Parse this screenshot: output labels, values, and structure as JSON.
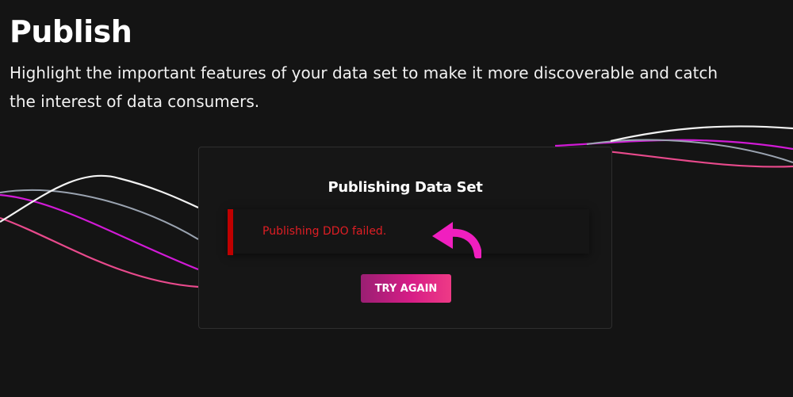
{
  "header": {
    "title": "Publish",
    "description": "Highlight the important features of your data set to make it more discoverable and catch the interest of data consumers."
  },
  "modal": {
    "title": "Publishing Data Set",
    "error_message": "Publishing DDO failed.",
    "try_again_label": "TRY AGAIN"
  },
  "icons": {
    "annotation": "curved-arrow-pointing-left"
  },
  "colors": {
    "background": "#141414",
    "error_red": "#e01e24",
    "error_bar": "#c00000",
    "accent_pink": "#e91e8c",
    "arrow_magenta": "#f01fbf",
    "wave_white": "#f2f2f2",
    "wave_gray": "#9aa3b0",
    "wave_magenta": "#d11ad6",
    "wave_pink": "#e84a8c"
  }
}
